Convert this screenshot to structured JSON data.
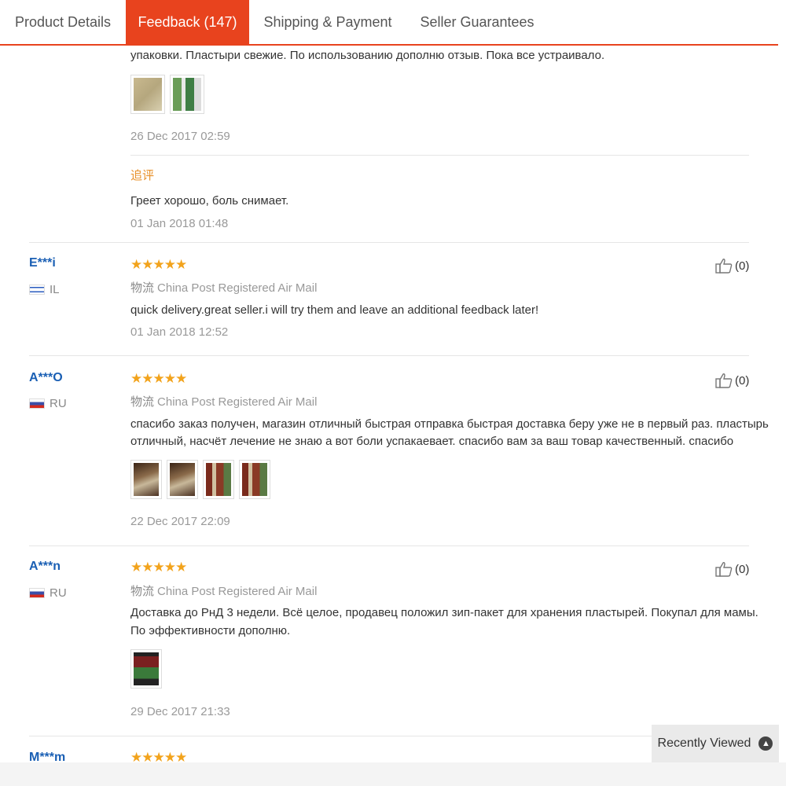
{
  "tabs": [
    {
      "label": "Product Details"
    },
    {
      "label": "Feedback (147)"
    },
    {
      "label": "Shipping & Payment"
    },
    {
      "label": "Seller Guarantees"
    }
  ],
  "review0": {
    "text_line": "упаковки. Пластыри свежие. По использованию дополню отзыв. Пока все устраивало.",
    "date": "26 Dec 2017 02:59",
    "additional_label": "追评",
    "additional_text": "Греет хорошо, боль снимает.",
    "additional_date": "01 Jan 2018 01:48"
  },
  "review1": {
    "user": "E***i",
    "country": "IL",
    "stars": "★★★★★",
    "rating": 5,
    "shipping_cn": "物流",
    "shipping": "China Post Registered Air Mail",
    "text": "quick delivery.great seller.i will try them and leave an additional feedback later!",
    "date": "01 Jan 2018 12:52",
    "helpful": "(0)"
  },
  "review2": {
    "user": "A***O",
    "country": "RU",
    "stars": "★★★★★",
    "rating": 5,
    "shipping_cn": "物流",
    "shipping": "China Post Registered Air Mail",
    "text1": "спасибо заказ получен, магазин отличный быстрая отправка быстрая доставка беру уже не в первый раз. пластырь",
    "text2": "отличный, насчёт лечение не знаю а вот боли успакаевает. спасибо вам за ваш товар качественный. спасибо",
    "date": "22 Dec 2017 22:09",
    "helpful": "(0)"
  },
  "review3": {
    "user": "A***n",
    "country": "RU",
    "stars": "★★★★★",
    "rating": 5,
    "shipping_cn": "物流",
    "shipping": "China Post Registered Air Mail",
    "text1": "Доставка до РнД 3 недели. Всё целое, продавец положил зип-пакет для хранения пластырей. Покупал для мамы.",
    "text2": "По эффективности дополню.",
    "date": "29 Dec 2017 21:33",
    "helpful": "(0)"
  },
  "review4": {
    "user": "M***m",
    "stars": "★★★★★",
    "rating": 5
  },
  "recently_viewed": "Recently Viewed",
  "colors": {
    "accent": "#e8431e",
    "link": "#1a5fb4",
    "star": "#f2a31c"
  }
}
